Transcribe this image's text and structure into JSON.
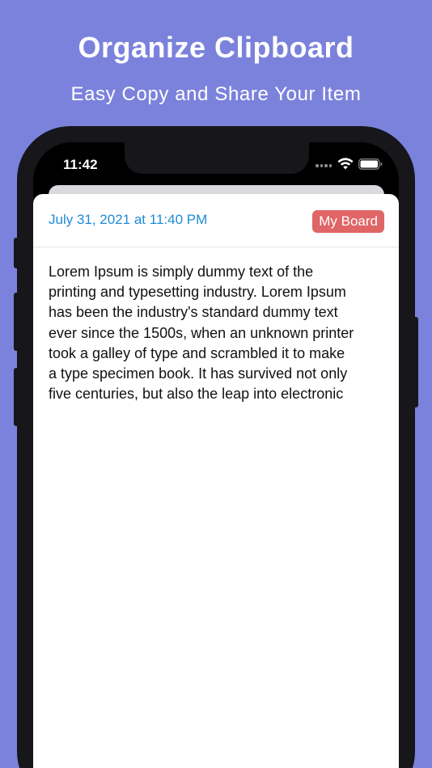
{
  "promo": {
    "title": "Organize Clipboard",
    "subtitle": "Easy Copy and Share Your Item"
  },
  "status_bar": {
    "time": "11:42",
    "icons": [
      "cellular-dots-icon",
      "wifi-icon",
      "battery-icon"
    ]
  },
  "clip": {
    "date": "July 31, 2021 at 11:40 PM",
    "board": "My Board",
    "lines": [
      "Lorem Ipsum is simply dummy text of the",
      "printing and typesetting industry. Lorem Ipsum",
      "has been the industry's standard dummy text",
      "ever since the 1500s, when an unknown printer",
      "took a galley of type and scrambled it to make",
      "a type specimen book. It has survived not only",
      "five centuries, but also the leap into electronic"
    ]
  },
  "colors": {
    "background": "#7b82dc",
    "date_text": "#1d8bd6",
    "board_badge": "#e06566",
    "phone_frame": "#17161b"
  }
}
